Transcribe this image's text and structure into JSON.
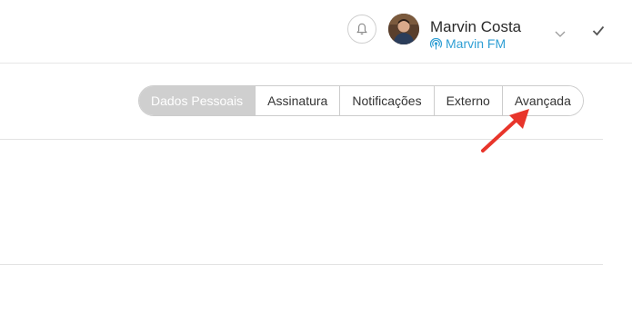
{
  "header": {
    "user": {
      "name": "Marvin Costa",
      "station": "Marvin FM"
    },
    "icons": [
      "bell-icon",
      "avatar",
      "radio-icon",
      "chevron-down-icon",
      "check-icon"
    ]
  },
  "tabs": [
    {
      "label": "Dados Pessoais",
      "active": true
    },
    {
      "label": "Assinatura",
      "active": false
    },
    {
      "label": "Notificações",
      "active": false
    },
    {
      "label": "Externo",
      "active": false
    },
    {
      "label": "Avançada",
      "active": false
    }
  ],
  "colors": {
    "accent": "#2f9fd4",
    "active_tab_bg": "#cfcfcf",
    "annotation_arrow": "#e8352b"
  }
}
